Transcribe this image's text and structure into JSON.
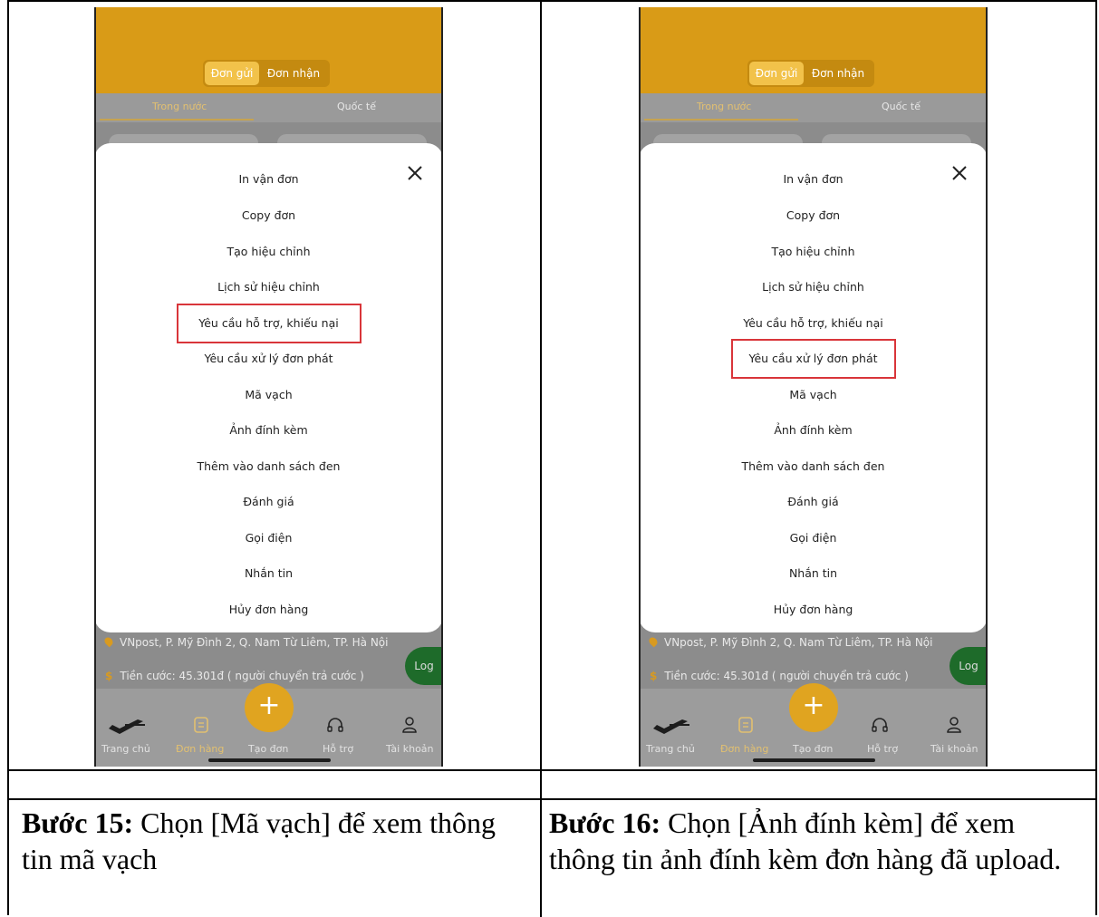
{
  "phones": [
    {
      "seg_sent": "Đơn gửi",
      "seg_received": "Đơn nhận",
      "tab_domestic": "Trong nước",
      "tab_international": "Quốc tế",
      "menu": [
        "In vận đơn",
        "Copy đơn",
        "Tạo hiệu chỉnh",
        "Lịch sử hiệu chỉnh",
        "Yêu cầu hỗ trợ, khiếu nại",
        "Yêu cầu xử lý đơn phát",
        "Mã vạch",
        "Ảnh đính kèm",
        "Thêm vào danh sách đen",
        "Đánh giá",
        "Gọi điện",
        "Nhắn tin",
        "Hủy đơn hàng"
      ],
      "highlighted_index": 4,
      "address": "VNpost, P. Mỹ Đình 2, Q. Nam Từ Liêm, TP. Hà Nội",
      "fee": "Tiền cước: 45.301đ ( người chuyển trả cước )",
      "log_label": "Log",
      "nav": [
        "Trang chủ",
        "Đơn hàng",
        "Tạo đơn",
        "Hỗ trợ",
        "Tài khoản"
      ],
      "nav_active": 1
    },
    {
      "seg_sent": "Đơn gửi",
      "seg_received": "Đơn nhận",
      "tab_domestic": "Trong nước",
      "tab_international": "Quốc tế",
      "menu": [
        "In vận đơn",
        "Copy đơn",
        "Tạo hiệu chỉnh",
        "Lịch sử hiệu chỉnh",
        "Yêu cầu hỗ trợ, khiếu nại",
        "Yêu cầu xử lý đơn phát",
        "Mã vạch",
        "Ảnh đính kèm",
        "Thêm vào danh sách đen",
        "Đánh giá",
        "Gọi điện",
        "Nhắn tin",
        "Hủy đơn hàng"
      ],
      "highlighted_index": 5,
      "address": "VNpost, P. Mỹ Đình 2, Q. Nam Từ Liêm, TP. Hà Nội",
      "fee": "Tiền cước: 45.301đ ( người chuyển trả cước )",
      "log_label": "Log",
      "nav": [
        "Trang chủ",
        "Đơn hàng",
        "Tạo đơn",
        "Hỗ trợ",
        "Tài khoản"
      ],
      "nav_active": 1
    }
  ],
  "captions": [
    {
      "step": "Bước 15:",
      "text": " Chọn [Mã vạch] để xem thông tin mã vạch"
    },
    {
      "step": "Bước 16:",
      "text": " Chọn [Ảnh đính kèm] để xem thông tin ảnh đính kèm đơn hàng đã upload."
    }
  ],
  "colors": {
    "brand": "#d99b17",
    "highlight": "#d9353a",
    "log_green": "#1e6b2a"
  }
}
